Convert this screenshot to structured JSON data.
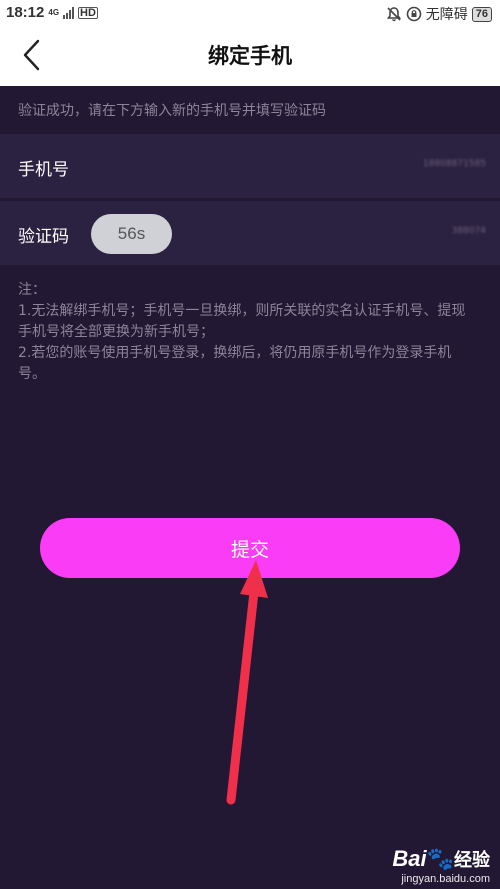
{
  "status_bar": {
    "time": "18:12",
    "network": "4G",
    "hd": "HD",
    "accessibility": "无障碍",
    "battery": "76"
  },
  "header": {
    "title": "绑定手机"
  },
  "instruction": "验证成功，请在下方输入新的手机号并填写验证码",
  "form": {
    "phone_label": "手机号",
    "phone_value": "18808871585",
    "code_label": "验证码",
    "code_value": "388074",
    "countdown": "56s"
  },
  "notes": {
    "heading": "注：",
    "line1": "1.无法解绑手机号；手机号一旦换绑，则所关联的实名认证手机号、提现手机号将全部更换为新手机号；",
    "line2": "2.若您的账号使用手机号登录，换绑后，将仍用原手机号作为登录手机号。"
  },
  "submit_label": "提交",
  "watermark": {
    "brand_prefix": "Bai",
    "brand_suffix": "经验",
    "url": "jingyan.baidu.com"
  },
  "colors": {
    "background": "#221833",
    "row": "#2b2140",
    "accent": "#fb3cf6",
    "annotation_arrow": "#f0304a"
  }
}
